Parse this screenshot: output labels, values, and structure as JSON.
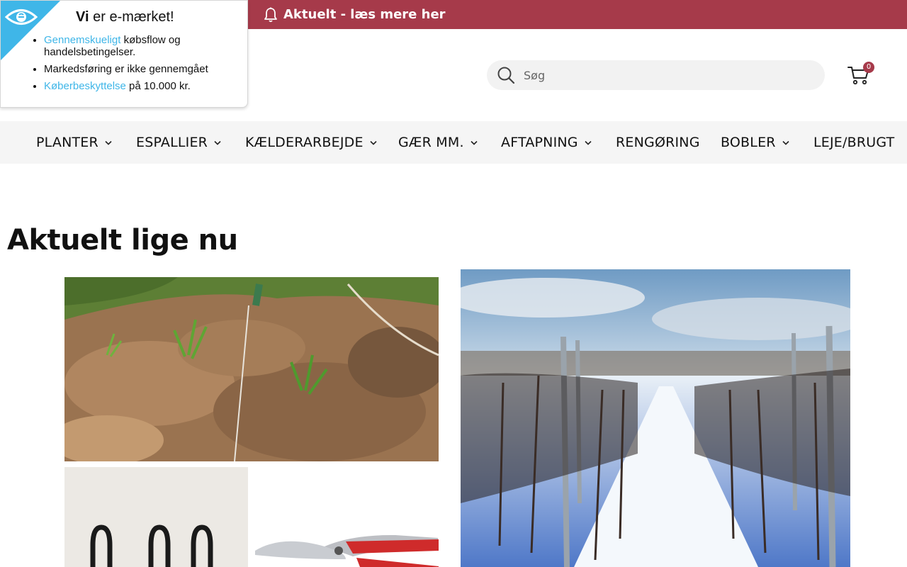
{
  "topbar": {
    "announcement": "Aktuelt - læs mere her",
    "bell_icon": "bell-icon",
    "color": "#a63a4a"
  },
  "emark": {
    "title_bold": "Vi",
    "title_rest": " er e-mærket!",
    "items": [
      {
        "link": "Gennemskueligt",
        "text": " købsflow og handelsbetingelser."
      },
      {
        "link": "",
        "text": "Markedsføring er ikke gennemgået"
      },
      {
        "link": "Køberbeskyttelse",
        "text": " på 10.000 kr."
      }
    ],
    "accent": "#3fb6e8"
  },
  "search": {
    "placeholder": "Søg",
    "icon": "search-icon"
  },
  "cart": {
    "count": "0",
    "icon": "cart-icon"
  },
  "nav": {
    "items": [
      {
        "label": "PLANTER",
        "dropdown": true
      },
      {
        "label": "ESPALLIER",
        "dropdown": true
      },
      {
        "label": "KÆLDERARBEJDE",
        "dropdown": true
      },
      {
        "label": "GÆR MM.",
        "dropdown": true
      },
      {
        "label": "AFTAPNING",
        "dropdown": true
      },
      {
        "label": "RENGØRING",
        "dropdown": false
      },
      {
        "label": "BOBLER",
        "dropdown": true
      },
      {
        "label": "LEJE/BRUGT",
        "dropdown": false
      }
    ]
  },
  "main": {
    "heading": "Aktuelt lige nu"
  }
}
